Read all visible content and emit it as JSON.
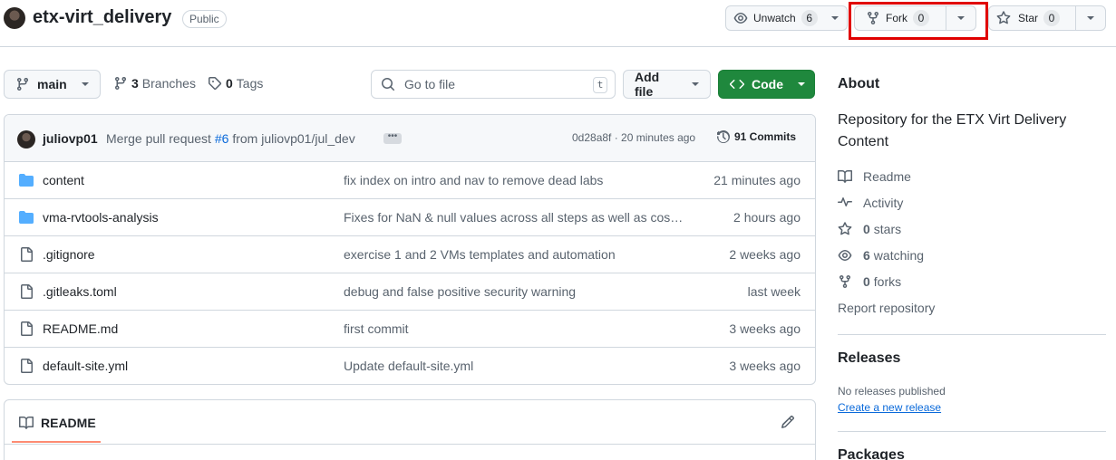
{
  "repo": {
    "name": "etx-virt_delivery",
    "visibility": "Public"
  },
  "header_actions": {
    "unwatch_label": "Unwatch",
    "unwatch_count": "6",
    "fork_label": "Fork",
    "fork_count": "0",
    "star_label": "Star",
    "star_count": "0"
  },
  "toolbar": {
    "branch": "main",
    "branches_count": "3",
    "branches_label": "Branches",
    "tags_count": "0",
    "tags_label": "Tags",
    "goto_placeholder": "Go to file",
    "goto_shortcut": "t",
    "add_file_label": "Add file",
    "code_label": "Code"
  },
  "latest_commit": {
    "author": "juliovp01",
    "message_prefix": "Merge pull request",
    "pr_ref": "#6",
    "message_suffix": "from juliovp01/jul_dev",
    "sha_time": "0d28a8f · 20 minutes ago",
    "commits_label": "91 Commits"
  },
  "files": [
    {
      "type": "folder",
      "name": "content",
      "message": "fix index on intro and nav to remove dead labs",
      "age": "21 minutes ago"
    },
    {
      "type": "folder",
      "name": "vma-rvtools-analysis",
      "message": "Fixes for NaN & null values across all steps as well as cos…",
      "age": "2 hours ago"
    },
    {
      "type": "file",
      "name": ".gitignore",
      "message": "exercise 1 and 2 VMs templates and automation",
      "age": "2 weeks ago"
    },
    {
      "type": "file",
      "name": ".gitleaks.toml",
      "message": "debug and false positive security warning",
      "age": "last week"
    },
    {
      "type": "file",
      "name": "README.md",
      "message": "first commit",
      "age": "3 weeks ago"
    },
    {
      "type": "file",
      "name": "default-site.yml",
      "message": "Update default-site.yml",
      "age": "3 weeks ago"
    }
  ],
  "readme": {
    "tab_label": "README"
  },
  "about": {
    "heading": "About",
    "description": "Repository for the ETX Virt Delivery Content",
    "readme_label": "Readme",
    "activity_label": "Activity",
    "stars_count": "0",
    "stars_label": "stars",
    "watching_count": "6",
    "watching_label": "watching",
    "forks_count": "0",
    "forks_label": "forks",
    "report_label": "Report repository"
  },
  "releases": {
    "heading": "Releases",
    "empty_text": "No releases published",
    "create_link": "Create a new release"
  },
  "packages": {
    "heading": "Packages"
  },
  "colors": {
    "primary_green": "#1f883d",
    "link_blue": "#0969da",
    "folder_blue": "#54aeff",
    "highlight_red": "#e00000",
    "tab_underline": "#fd8c73"
  }
}
